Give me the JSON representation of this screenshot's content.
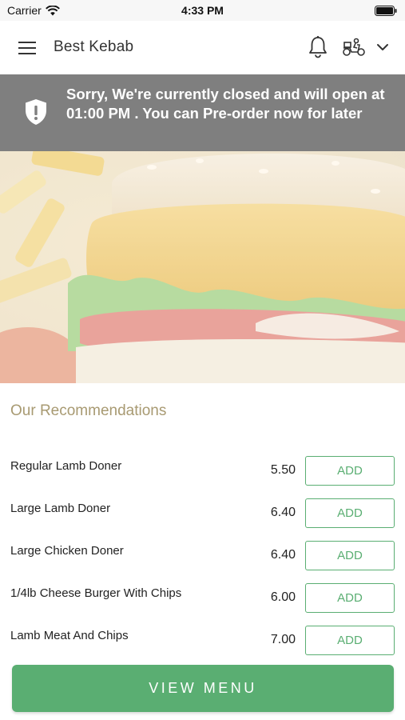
{
  "status_bar": {
    "carrier": "Carrier",
    "time": "4:33 PM"
  },
  "header": {
    "title": "Best Kebab",
    "icons": [
      "menu-icon",
      "bell-icon",
      "scooter-icon",
      "chevron-down-icon"
    ]
  },
  "banner": {
    "message": "Sorry, We're currently closed and will open at 01:00 PM . You can Pre-order now for later",
    "icon": "shield-exclamation-icon",
    "background": "#7f7f7f"
  },
  "recommendations": {
    "title": "Our Recommendations",
    "items": [
      {
        "name": "Regular Lamb Doner",
        "price": "5.50",
        "button": "ADD"
      },
      {
        "name": "Large Lamb Doner",
        "price": "6.40",
        "button": "ADD"
      },
      {
        "name": "Large Chicken Doner",
        "price": "6.40",
        "button": "ADD"
      },
      {
        "name": "1/4lb Cheese Burger With Chips",
        "price": "6.00",
        "button": "ADD"
      },
      {
        "name": "Lamb Meat And Chips",
        "price": "7.00",
        "button": "ADD"
      }
    ]
  },
  "footer": {
    "view_menu_label": "VIEW MENU"
  },
  "colors": {
    "accent_green": "#5aae72",
    "section_title": "#a89a72"
  }
}
